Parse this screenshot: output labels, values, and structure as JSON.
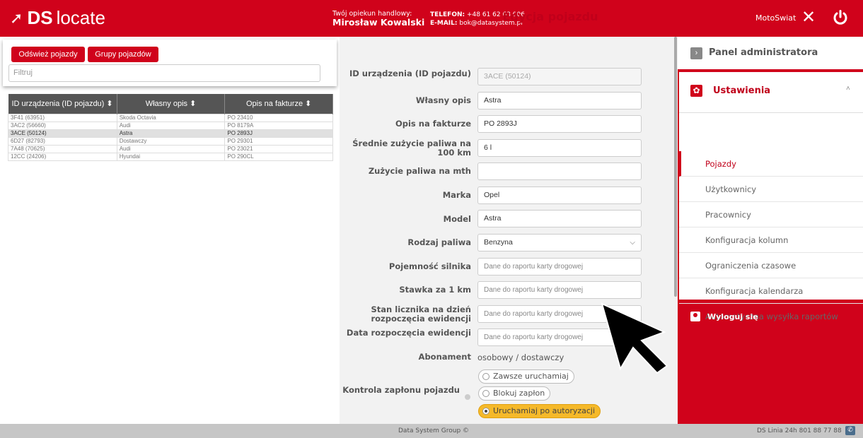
{
  "header": {
    "logo_bold": "DS",
    "logo_light": "locate",
    "contact_label": "Twój opiekun handlowy:",
    "contact_name": "Mirosław Kowalski",
    "phone_label": "TELEFON:",
    "phone": "+48 61 62 63 006",
    "email_label": "E-MAIL:",
    "email": "bok@datasystem.pl",
    "user": "MotoSwiat",
    "close_icon": "close-icon",
    "power_icon": "power-icon",
    "accent_color": "#d0021b"
  },
  "left": {
    "refresh_label": "Odśwież pojazdy",
    "groups_label": "Grupy pojazdów",
    "filter_placeholder": "Filtruj",
    "columns": [
      "ID urządzenia (ID pojazdu) ⬍",
      "Własny opis ⬍",
      "Opis na fakturze ⬍"
    ],
    "rows": [
      {
        "id": "3F41 (63951)",
        "desc": "Skoda Octavia",
        "invoice": "PO 23410"
      },
      {
        "id": "3AC2 (56660)",
        "desc": "Audi",
        "invoice": "PO 8179A"
      },
      {
        "id": "3ACE (50124)",
        "desc": "Astra",
        "invoice": "PO 2893J"
      },
      {
        "id": "6D27 (82793)",
        "desc": "Dostawczy",
        "invoice": "PO 29301"
      },
      {
        "id": "7A48 (70625)",
        "desc": "Audi",
        "invoice": "PO 23021"
      },
      {
        "id": "12CC (24206)",
        "desc": "Hyundai",
        "invoice": "PO 290CL"
      }
    ]
  },
  "form": {
    "title": "Edycja pojazdu",
    "device_id_label": "ID urządzenia (ID pojazdu)",
    "device_id_value": "3ACE (50124)",
    "own_desc_label": "Własny opis",
    "own_desc_value": "Astra",
    "invoice_desc_label": "Opis na fakturze",
    "invoice_desc_value": "PO 2893J",
    "avg_fuel_label": "Średnie zużycie paliwa na 100 km",
    "avg_fuel_value": "6 l",
    "fuel_mth_label": "Zużycie paliwa na mth",
    "fuel_mth_value": "",
    "brand_label": "Marka",
    "brand_value": "Opel",
    "model_label": "Model",
    "model_value": "Astra",
    "fuel_type_label": "Rodzaj paliwa",
    "fuel_type_value": "Benzyna",
    "engine_label": "Pojemność silnika",
    "engine_placeholder": "Dane do raportu karty drogowej",
    "rate_label": "Stawka za 1 km",
    "rate_placeholder": "Dane do raportu karty drogowej",
    "odometer_label": "Stan licznika na dzień rozpoczęcia ewidencji",
    "odometer_placeholder": "Dane do raportu karty drogowej",
    "start_date_label": "Data rozpoczęcia ewidencji",
    "start_date_placeholder": "Dane do raportu karty drogowej",
    "subscription_label": "Abonament",
    "subscription_value": "osobowy / dostawczy",
    "ignition_label": "Kontrola zapłonu pojazdu",
    "ignition_options": [
      "Zawsze uruchamiaj",
      "Blokuj zapłon",
      "Uruchamiaj po autoryzacji"
    ]
  },
  "admin": {
    "panel_title": "Panel administratora",
    "settings_title": "Ustawienia",
    "menu": [
      "Pojazdy",
      "Użytkownicy",
      "Pracownicy",
      "Konfiguracja kolumn",
      "Ograniczenia czasowe",
      "Konfiguracja kalendarza",
      "Automatyczna wysyłka raportów"
    ],
    "logout": "Wyloguj się"
  },
  "footer": {
    "company": "Data System Group ©",
    "hotline": "DS Linia 24h 801 88 77 88"
  }
}
